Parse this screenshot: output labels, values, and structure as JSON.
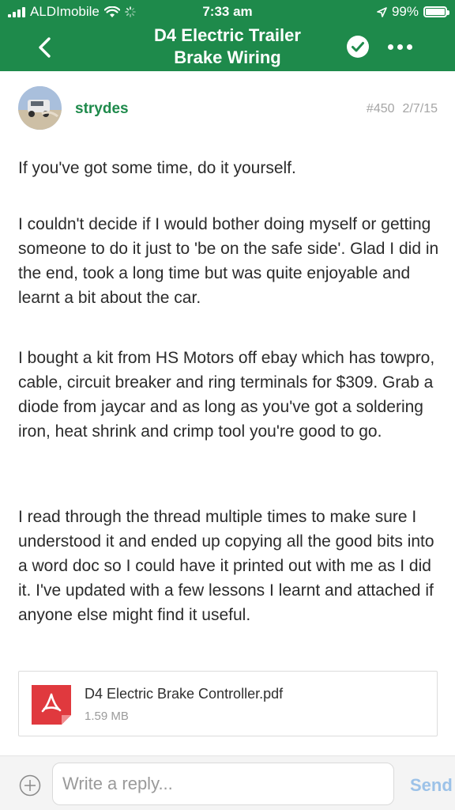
{
  "status_bar": {
    "carrier": "ALDImobile",
    "time": "7:33 am",
    "battery": "99%",
    "battery_level": 0.99
  },
  "header": {
    "title_line1": "D4 Electric Trailer",
    "title_line2": "Brake Wiring"
  },
  "post": {
    "username": "strydes",
    "number": "#450",
    "date": "2/7/15",
    "paragraphs": [
      "If you've got some time, do it yourself.",
      "I couldn't decide if I would bother doing myself or getting someone to do it just to 'be on the safe side'. Glad I did in the end, took a long time but was quite enjoyable and learnt a bit about the car.",
      "I bought a kit from HS Motors off ebay which has towpro, cable, circuit breaker and ring terminals for $309. Grab a diode from jaycar and as long as you've got a soldering iron, heat shrink and crimp tool you're good to go.",
      "I read through the thread multiple times to make sure I understood it and ended up copying all the good bits into a word doc so I could have it printed out with me as I did it. I've updated with a few lessons I learnt and attached if anyone else might find it useful."
    ],
    "attachment": {
      "file_name": "D4 Electric Brake Controller.pdf",
      "file_size": "1.59 MB"
    }
  },
  "reply": {
    "placeholder": "Write a reply...",
    "send_label": "Send"
  },
  "colors": {
    "brand_green": "#1e8a4b",
    "pdf_red": "#e0393e",
    "send_blue": "#9cc2e8"
  }
}
